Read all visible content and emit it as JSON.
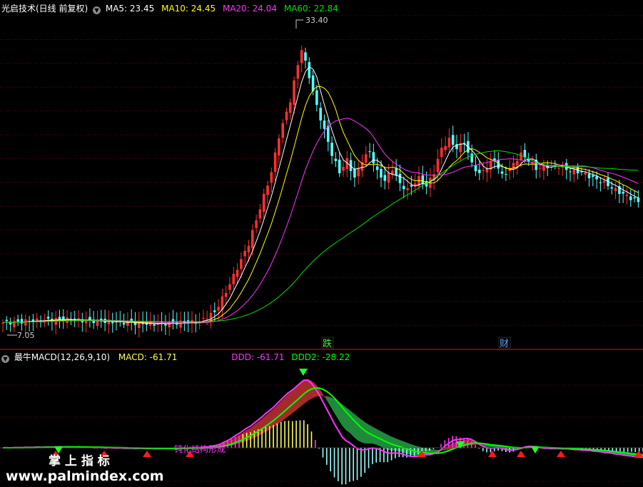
{
  "header_top": {
    "title": "光启技术(日线 前复权)",
    "ma": [
      {
        "label": "MA5: 23.45",
        "color": "#ffffff"
      },
      {
        "label": "MA10: 24.45",
        "color": "#ffff00"
      },
      {
        "label": "MA20: 24.04",
        "color": "#ff33ff"
      },
      {
        "label": "MA60: 22.84",
        "color": "#00dd00"
      }
    ]
  },
  "header_bottom": {
    "title": "最牛MACD(12,26,9,10)",
    "macd_label": "MACD: -61.71",
    "ddd_label": "DDD: -61.71",
    "ddd2_label": "DDD2: -28.22"
  },
  "chart_data": [
    {
      "type": "candlestick",
      "title": "光启技术(日线 前复权)",
      "y_range": [
        7.05,
        33.4
      ],
      "annotations": {
        "high": "33.40",
        "low": "7.05",
        "markers": [
          "跌",
          "财"
        ]
      },
      "series": [
        {
          "name": "MA5",
          "color": "#ffffff"
        },
        {
          "name": "MA10",
          "color": "#ffff00"
        },
        {
          "name": "MA20",
          "color": "#ff33ff"
        },
        {
          "name": "MA60",
          "color": "#00dd00"
        }
      ],
      "colors": {
        "up": "#ff3030",
        "down": "#55ffff"
      }
    },
    {
      "type": "area",
      "title": "最牛MACD(12,26,9,10)",
      "series": [
        {
          "name": "MACD",
          "color": "#ffff55"
        },
        {
          "name": "DDD",
          "color": "#ff33ff"
        },
        {
          "name": "DDD2",
          "color": "#00ff00"
        }
      ],
      "annotations": [
        "钝化结构形成"
      ]
    }
  ],
  "watermark": {
    "line1": "掌 上 指 标",
    "line2": "www.palmindex.com"
  }
}
